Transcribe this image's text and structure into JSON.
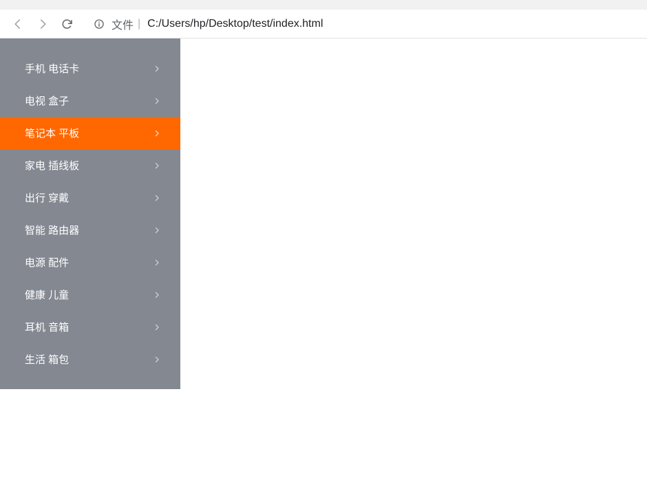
{
  "browser": {
    "url_file_label": "文件",
    "url_path": "C:/Users/hp/Desktop/test/index.html"
  },
  "sidebar": {
    "items": [
      {
        "label": "手机 电话卡",
        "active": false
      },
      {
        "label": "电视 盒子",
        "active": false
      },
      {
        "label": "笔记本 平板",
        "active": true
      },
      {
        "label": "家电 插线板",
        "active": false
      },
      {
        "label": "出行 穿戴",
        "active": false
      },
      {
        "label": "智能 路由器",
        "active": false
      },
      {
        "label": "电源 配件",
        "active": false
      },
      {
        "label": "健康 儿童",
        "active": false
      },
      {
        "label": "耳机 音箱",
        "active": false
      },
      {
        "label": "生活 箱包",
        "active": false
      }
    ]
  }
}
